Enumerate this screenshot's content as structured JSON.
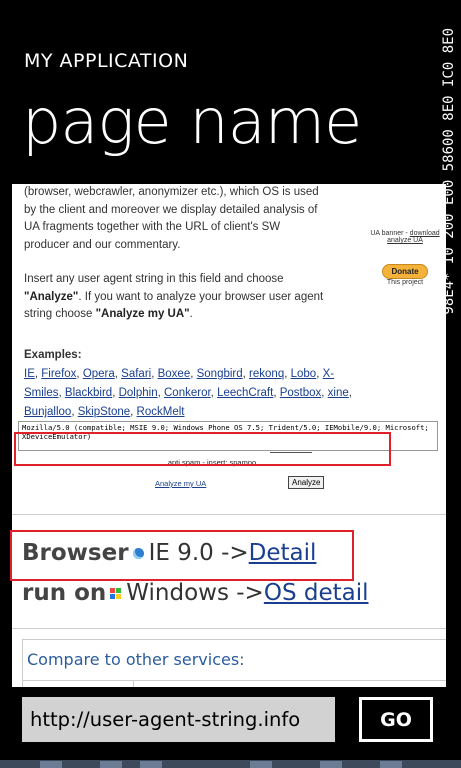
{
  "header": {
    "app_title": "MY APPLICATION",
    "page_name": "page name",
    "side_counter": "98E4* I0 200 E00 58600 8E0 IC0 8E0"
  },
  "page": {
    "intro_p1": "(browser, webcrawler, anonymizer etc.), which OS is used by the client and moreover we display detailed analysis of UA fragments together with the URL of client's SW producer and our commentary.",
    "intro_p2_a": "Insert any user agent string in this field and choose ",
    "intro_p2_b": "\"Analyze\"",
    "intro_p2_c": ". If you want to analyze your browser user agent string choose ",
    "intro_p2_d": "\"Analyze my UA\"",
    "intro_p2_e": ".",
    "banner": {
      "label": "UA banner - ",
      "download": "download",
      "analyze": "analyze UA",
      "donate": "Donate",
      "project": "This project"
    },
    "examples_label": "Examples:",
    "examples": [
      "IE",
      "Firefox",
      "Opera",
      "Safari",
      "Boxee",
      "Songbird",
      "rekonq",
      "Lobo",
      "X-Smiles",
      "Blackbird",
      "Dolphin",
      "Conkeror",
      "LeechCraft",
      "Postbox",
      "xine",
      "Bunjalloo",
      "SkipStone",
      "RockMelt"
    ],
    "ua_string": "Mozilla/5.0 (compatible; MSIE 9.0; Windows Phone OS 7.5; Trident/5.0; IEMobile/9.0; Microsoft; XDeviceEmulator)",
    "antispam": "anti spam - insert: spamno",
    "analyze_my_ua": "Analyze my UA",
    "analyze_button": "Analyze",
    "browser_label": "Browser",
    "browser_value": "IE 9.0 ->",
    "browser_link": "Detail",
    "os_label": "run on",
    "os_value": "Windows ->",
    "os_link": "OS detail",
    "compare_heading": "Compare to other services:"
  },
  "address_bar": {
    "url": "http://user-agent-string.info",
    "go_label": "GO"
  },
  "colors": {
    "highlight": "#e0202a",
    "link": "#1a3f8f",
    "address_bg": "#d2d2d2"
  }
}
